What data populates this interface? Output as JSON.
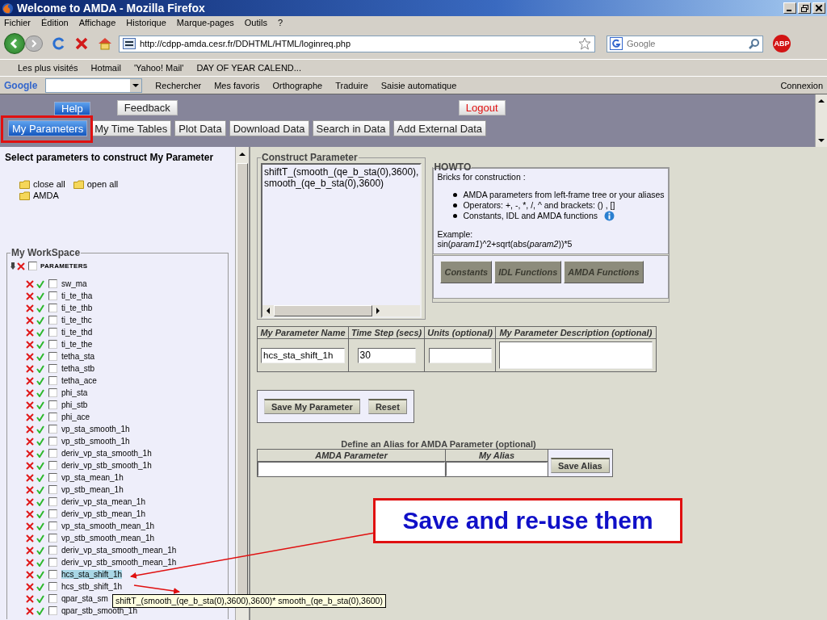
{
  "window": {
    "title": "Welcome to AMDA - Mozilla Firefox"
  },
  "menu": [
    "Fichier",
    "Édition",
    "Affichage",
    "Historique",
    "Marque-pages",
    "Outils",
    "?"
  ],
  "navigation": {
    "url": "http://cdpp-amda.cesr.fr/DDHTML/HTML/loginreq.php",
    "search_placeholder": "Google",
    "adblock_label": "ABP"
  },
  "bookmarks": [
    "Les plus visités",
    "Hotmail",
    "'Yahoo! Mail'",
    "DAY OF YEAR CALEND..."
  ],
  "google_toolbar": {
    "logo": "Google",
    "items": [
      "Rechercher",
      "Mes favoris",
      "Orthographe",
      "Traduire",
      "Saisie automatique"
    ],
    "sign_in": "Connexion"
  },
  "top_links": [
    {
      "label": "Help",
      "kind": "help"
    },
    {
      "label": "Feedback",
      "kind": "plain"
    },
    {
      "label": "Logout",
      "kind": "logout"
    }
  ],
  "tabs": [
    {
      "label": "My Parameters",
      "selected": true
    },
    {
      "label": "My Time Tables",
      "selected": false
    },
    {
      "label": "Plot Data",
      "selected": false
    },
    {
      "label": "Download Data",
      "selected": false
    },
    {
      "label": "Search in Data",
      "selected": false
    },
    {
      "label": "Add External Data",
      "selected": false
    }
  ],
  "left": {
    "heading": "Select parameters to construct My Parameter",
    "tree_actions": [
      "close all",
      "open all"
    ],
    "root": "AMDA",
    "workspace": {
      "title": "My WorkSpace",
      "header": "PARAMETERS",
      "header_checked": false,
      "items": [
        {
          "label": "sw_ma",
          "checked": false,
          "selected": false
        },
        {
          "label": "ti_te_tha",
          "checked": false,
          "selected": false
        },
        {
          "label": "ti_te_thb",
          "checked": false,
          "selected": false
        },
        {
          "label": "ti_te_thc",
          "checked": false,
          "selected": false
        },
        {
          "label": "ti_te_thd",
          "checked": false,
          "selected": false
        },
        {
          "label": "ti_te_the",
          "checked": false,
          "selected": false
        },
        {
          "label": "tetha_sta",
          "checked": false,
          "selected": false
        },
        {
          "label": "tetha_stb",
          "checked": false,
          "selected": false
        },
        {
          "label": "tetha_ace",
          "checked": false,
          "selected": false
        },
        {
          "label": "phi_sta",
          "checked": false,
          "selected": false
        },
        {
          "label": "phi_stb",
          "checked": false,
          "selected": false
        },
        {
          "label": "phi_ace",
          "checked": false,
          "selected": false
        },
        {
          "label": "vp_sta_smooth_1h",
          "checked": false,
          "selected": false
        },
        {
          "label": "vp_stb_smooth_1h",
          "checked": false,
          "selected": false
        },
        {
          "label": "deriv_vp_sta_smooth_1h",
          "checked": false,
          "selected": false
        },
        {
          "label": "deriv_vp_stb_smooth_1h",
          "checked": false,
          "selected": false
        },
        {
          "label": "vp_sta_mean_1h",
          "checked": false,
          "selected": false
        },
        {
          "label": "vp_stb_mean_1h",
          "checked": false,
          "selected": false
        },
        {
          "label": "deriv_vp_sta_mean_1h",
          "checked": false,
          "selected": false
        },
        {
          "label": "deriv_vp_stb_mean_1h",
          "checked": false,
          "selected": false
        },
        {
          "label": "vp_sta_smooth_mean_1h",
          "checked": false,
          "selected": false
        },
        {
          "label": "vp_stb_smooth_mean_1h",
          "checked": false,
          "selected": false
        },
        {
          "label": "deriv_vp_sta_smooth_mean_1h",
          "checked": false,
          "selected": false
        },
        {
          "label": "deriv_vp_stb_smooth_mean_1h",
          "checked": false,
          "selected": false
        },
        {
          "label": "hcs_sta_shift_1h",
          "checked": false,
          "selected": true
        },
        {
          "label": "hcs_stb_shift_1h",
          "checked": false,
          "selected": false
        },
        {
          "label": "qpar_sta_sm",
          "checked": false,
          "selected": false
        },
        {
          "label": "qpar_stb_smooth_1h",
          "checked": false,
          "selected": false
        }
      ]
    }
  },
  "construct": {
    "title": "Construct Parameter",
    "formula_lines": [
      "shiftT_(smooth_(qe_b_sta(0),3600),",
      "smooth_(qe_b_sta(0),3600)"
    ]
  },
  "howto": {
    "title": "HOWTO",
    "intro": "Bricks for construction :",
    "bullets": [
      "AMDA parameters from left-frame tree or your aliases",
      "Operators: +, -, *, /, ^ and brackets: () , []",
      "Constants, IDL and AMDA functions"
    ],
    "example_label": "Example:",
    "example": "sin(*param1*)^2+sqrt(abs(*param2*))*5",
    "buttons": [
      "Constants",
      "IDL Functions",
      "AMDA Functions"
    ]
  },
  "parameter_form": {
    "columns": [
      "My Parameter Name",
      "Time Step (secs)",
      "Units (optional)",
      "My Parameter Description (optional)"
    ],
    "name_value": "hcs_sta_shift_1h",
    "time_step_value": "30",
    "buttons": [
      "Save My Parameter",
      "Reset"
    ]
  },
  "alias": {
    "title": "Define an Alias for AMDA Parameter (optional)",
    "columns": [
      "AMDA Parameter",
      "My Alias"
    ],
    "button": "Save Alias"
  },
  "callout": {
    "text": "Save and re-use them"
  },
  "tooltip": {
    "text": "shiftT_(smooth_(qe_b_sta(0),3600),3600)* smooth_(qe_b_sta(0),3600)"
  }
}
